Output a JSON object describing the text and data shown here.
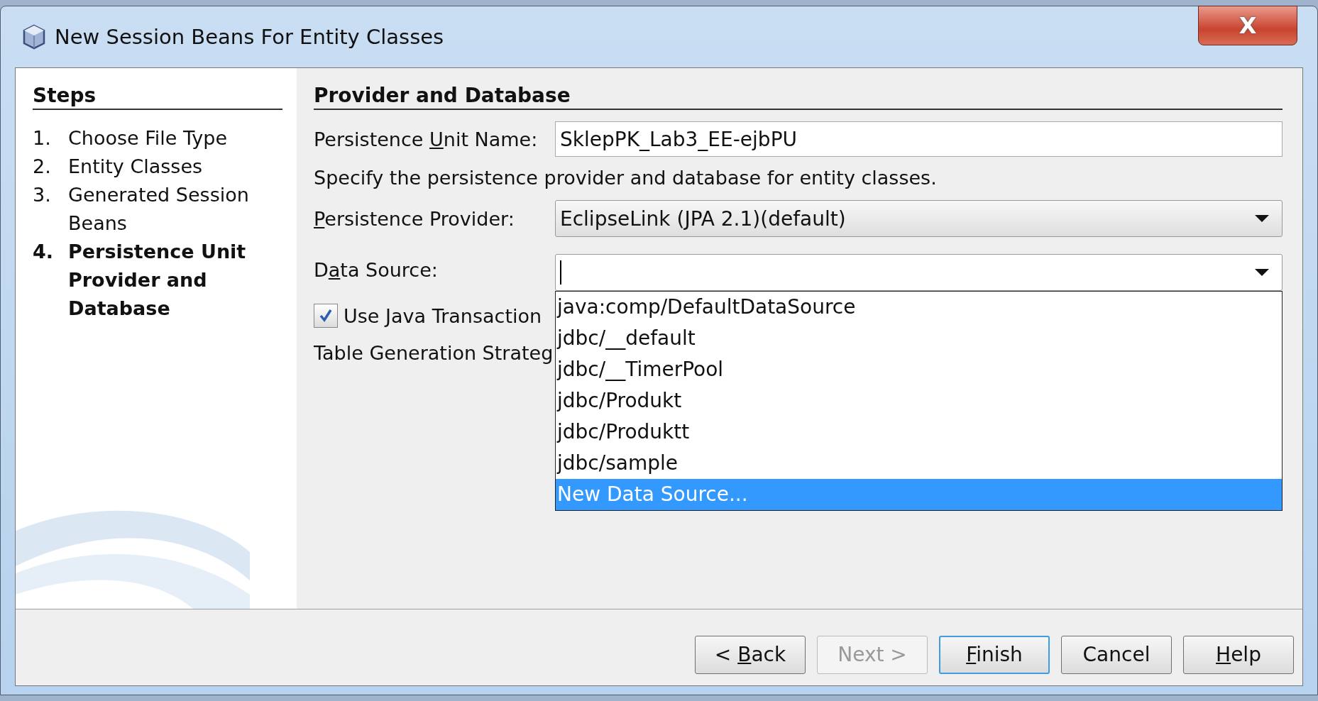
{
  "window": {
    "title": "New Session Beans For Entity Classes",
    "close_label": "X"
  },
  "steps": {
    "title": "Steps",
    "items": [
      {
        "number": "1.",
        "label": "Choose File Type",
        "selected": false
      },
      {
        "number": "2.",
        "label": "Entity Classes",
        "selected": false
      },
      {
        "number": "3.",
        "label": "Generated Session Beans",
        "selected": false
      },
      {
        "number": "4.",
        "label": "Persistence Unit Provider and Database",
        "selected": true
      }
    ]
  },
  "panel": {
    "title": "Provider and Database",
    "unit_name": {
      "label": {
        "before": "Persistence ",
        "key": "U",
        "after": "nit Name:"
      },
      "value": "SklepPK_Lab3_EE-ejbPU"
    },
    "description": "Specify the persistence provider and database for entity classes.",
    "provider": {
      "label": {
        "key": "P",
        "after": "ersistence Provider:"
      },
      "value": "EclipseLink (JPA 2.1)(default)"
    },
    "data_source": {
      "label": {
        "before": "D",
        "key": "a",
        "after": "ta Source:"
      },
      "focused": true,
      "expanded": true,
      "options": [
        {
          "label": "java:comp/DefaultDataSource",
          "selected": false
        },
        {
          "label": "jdbc/__default",
          "selected": false
        },
        {
          "label": "jdbc/__TimerPool",
          "selected": false
        },
        {
          "label": "jdbc/Produkt",
          "selected": false
        },
        {
          "label": "jdbc/Produktt",
          "selected": false
        },
        {
          "label": "jdbc/sample",
          "selected": false
        },
        {
          "label": "New Data Source...",
          "selected": true
        }
      ]
    },
    "use_jta": {
      "label": {
        "before": "Use ",
        "key": "J",
        "after": "ava Transaction"
      },
      "checked": true
    },
    "table_generation": {
      "label": "Table Generation Strateg"
    }
  },
  "buttons": [
    {
      "label": {
        "before": "< ",
        "key": "B",
        "after": "ack"
      },
      "disabled": false,
      "default": false
    },
    {
      "label": {
        "after": "Next >"
      },
      "disabled": true,
      "default": false
    },
    {
      "label": {
        "key": "F",
        "after": "inish"
      },
      "disabled": false,
      "default": true
    },
    {
      "label": {
        "after": "Cancel"
      },
      "disabled": false,
      "default": false
    },
    {
      "label": {
        "key": "H",
        "after": "elp"
      },
      "disabled": false,
      "default": false
    }
  ]
}
